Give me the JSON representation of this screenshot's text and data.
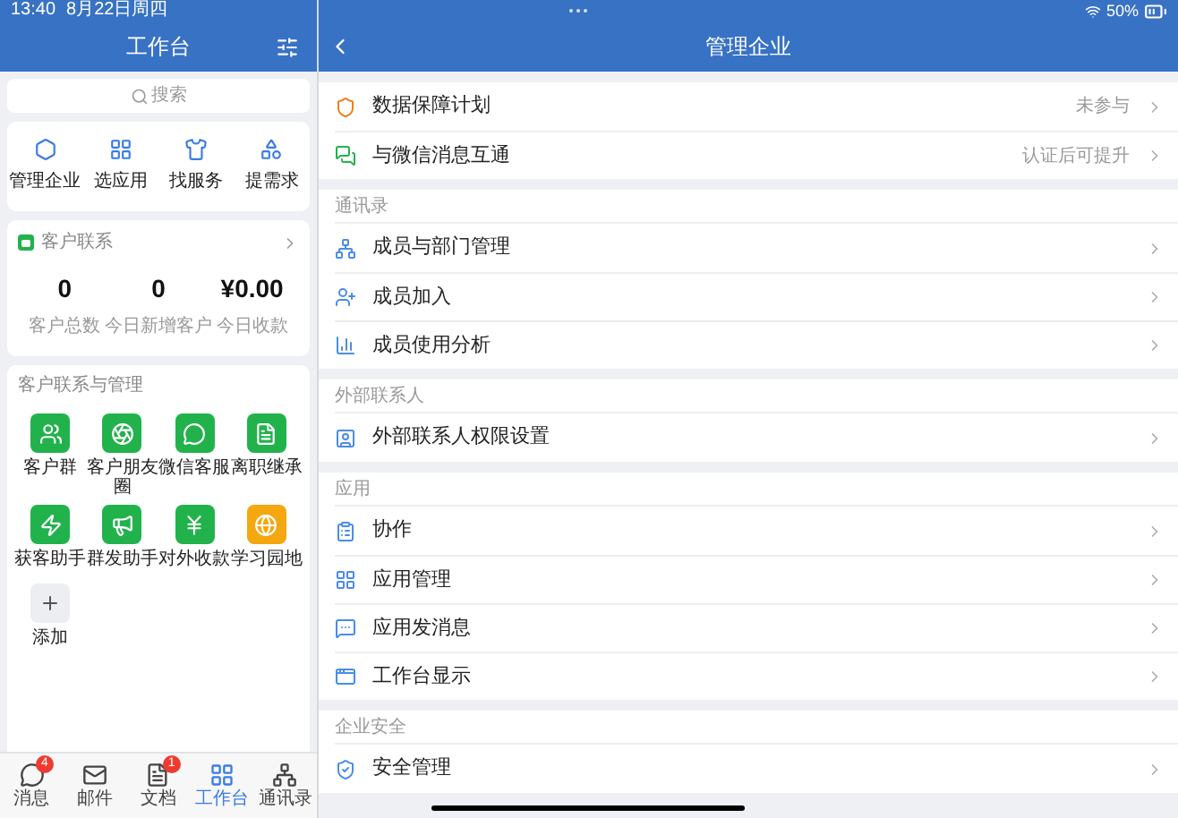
{
  "status_bar": {
    "time": "13:40",
    "date": "8月22日周四",
    "battery": "50%"
  },
  "sidebar": {
    "title": "工作台",
    "search": {
      "placeholder": "搜索"
    },
    "quick_apps": [
      {
        "label": "管理企业",
        "kind": "hex"
      },
      {
        "label": "选应用",
        "kind": "grid"
      },
      {
        "label": "找服务",
        "kind": "tie"
      },
      {
        "label": "提需求",
        "kind": "shapes"
      }
    ],
    "customer_contact": {
      "title": "客户联系",
      "stats": [
        {
          "value": "0",
          "label": "客户总数"
        },
        {
          "value": "0",
          "label": "今日新增客户"
        },
        {
          "value": "¥0.00",
          "label": "今日收款"
        }
      ]
    },
    "management": {
      "title": "客户联系与管理",
      "apps": [
        {
          "label": "客户群",
          "kind": "group",
          "color": "#22b24c"
        },
        {
          "label": "客户朋友圈",
          "kind": "aperture",
          "color": "#22b24c"
        },
        {
          "label": "微信客服",
          "kind": "chat",
          "color": "#22b24c"
        },
        {
          "label": "离职继承",
          "kind": "doc",
          "color": "#22b24c"
        },
        {
          "label": "获客助手",
          "kind": "bolt",
          "color": "#22b24c"
        },
        {
          "label": "群发助手",
          "kind": "megaphone",
          "color": "#22b24c"
        },
        {
          "label": "对外收款",
          "kind": "yen",
          "color": "#22b24c"
        },
        {
          "label": "学习园地",
          "kind": "planet",
          "color": "#f5a70f"
        }
      ],
      "add_label": "添加"
    },
    "tab_bar": [
      {
        "label": "消息",
        "kind": "chat",
        "badge": "4",
        "selected": false
      },
      {
        "label": "邮件",
        "kind": "mail",
        "selected": false
      },
      {
        "label": "文档",
        "kind": "doc",
        "badge": "1",
        "selected": false
      },
      {
        "label": "工作台",
        "kind": "grid",
        "selected": true
      },
      {
        "label": "通讯录",
        "kind": "org",
        "selected": false
      }
    ]
  },
  "detail": {
    "title": "管理企业",
    "sections": [
      {
        "rows": [
          {
            "label": "数据保障计划",
            "kind": "shield",
            "value": "未参与"
          },
          {
            "label": "与微信消息互通",
            "kind": "wechat",
            "value": "认证后可提升"
          }
        ]
      },
      {
        "header": "通讯录",
        "rows": [
          {
            "label": "成员与部门管理",
            "kind": "org"
          },
          {
            "label": "成员加入",
            "kind": "useradd"
          },
          {
            "label": "成员使用分析",
            "kind": "chart"
          }
        ]
      },
      {
        "header": "外部联系人",
        "rows": [
          {
            "label": "外部联系人权限设置",
            "kind": "contact"
          }
        ]
      },
      {
        "header": "应用",
        "rows": [
          {
            "label": "协作",
            "kind": "collab"
          },
          {
            "label": "应用管理",
            "kind": "grid"
          },
          {
            "label": "应用发消息",
            "kind": "message"
          },
          {
            "label": "工作台显示",
            "kind": "display"
          }
        ]
      },
      {
        "header": "企业安全",
        "rows": [
          {
            "label": "安全管理",
            "kind": "security"
          }
        ]
      }
    ]
  }
}
